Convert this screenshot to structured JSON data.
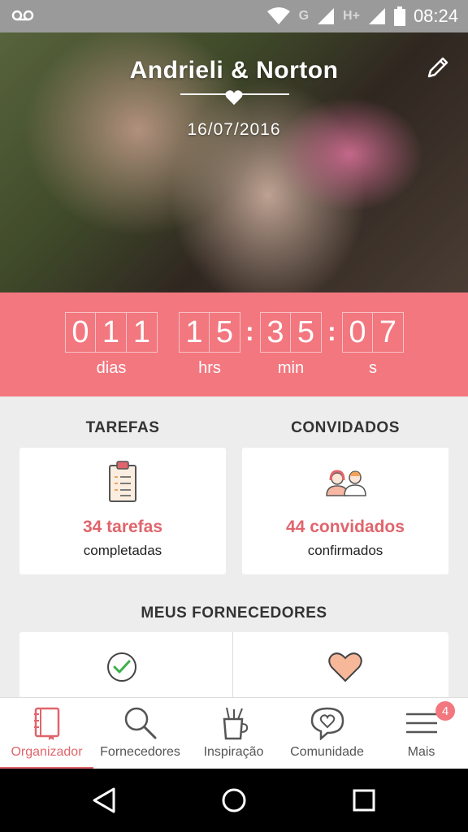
{
  "status_bar": {
    "network_label": "G",
    "network_label2": "H+",
    "time": "08:24"
  },
  "hero": {
    "title": "Andrieli & Norton",
    "date": "16/07/2016"
  },
  "countdown": {
    "days_digits": [
      "0",
      "1",
      "1"
    ],
    "hours_digits": [
      "1",
      "5"
    ],
    "minutes_digits": [
      "3",
      "5"
    ],
    "seconds_digits": [
      "0",
      "7"
    ],
    "labels": {
      "days": "dias",
      "hours": "hrs",
      "minutes": "min",
      "seconds": "s"
    }
  },
  "tasks": {
    "title": "TAREFAS",
    "count_text": "34 tarefas",
    "status_text": "completadas"
  },
  "guests": {
    "title": "CONVIDADOS",
    "count_text": "44 convidados",
    "status_text": "confirmados"
  },
  "vendors": {
    "title": "MEUS FORNECEDORES"
  },
  "bottom_nav": {
    "items": [
      {
        "label": "Organizador",
        "icon": "notebook-icon"
      },
      {
        "label": "Fornecedores",
        "icon": "search-icon"
      },
      {
        "label": "Inspiração",
        "icon": "cup-icon"
      },
      {
        "label": "Comunidade",
        "icon": "chat-heart-icon"
      },
      {
        "label": "Mais",
        "icon": "menu-icon"
      }
    ],
    "badge": "4"
  },
  "colors": {
    "accent": "#f2777f",
    "accent_text": "#e0656c"
  }
}
